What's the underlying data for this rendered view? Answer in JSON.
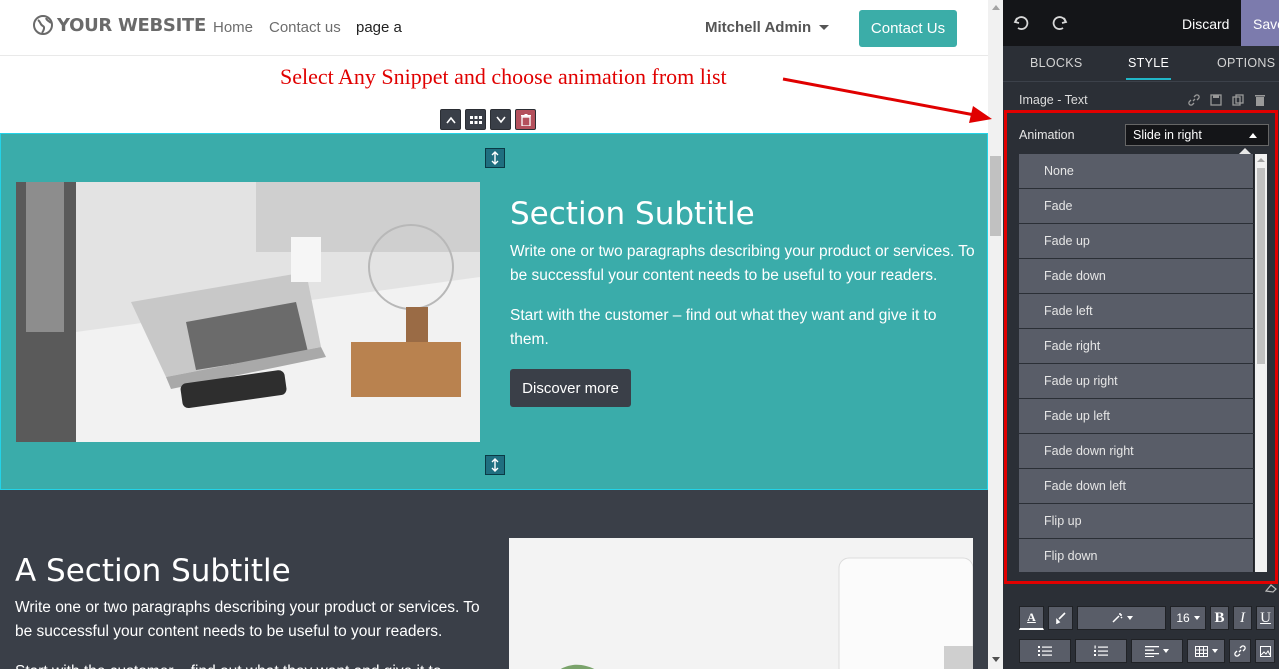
{
  "site": {
    "logo_text": "YOUR WEBSITE",
    "nav": {
      "home": "Home",
      "contact": "Contact us",
      "page_a": "page a"
    },
    "user": "Mitchell Admin",
    "cta": "Contact Us"
  },
  "annotation": "Select Any Snippet and choose animation from list",
  "section1": {
    "title": "Section Subtitle",
    "para1": "Write one or two paragraphs describing your product or services. To be successful your content needs to be useful to your readers.",
    "para2": "Start with the customer – find out what they want and give it to them.",
    "button": "Discover more"
  },
  "section2": {
    "title": "A Section Subtitle",
    "para1": "Write one or two paragraphs describing your product or services. To be successful your content needs to be useful to your readers.",
    "para2_partial": "Start with the customer – find out what they want and give it to"
  },
  "editor": {
    "discard": "Discard",
    "save": "Save",
    "tabs": [
      "BLOCKS",
      "STYLE",
      "OPTIONS"
    ],
    "active_tab": "STYLE",
    "snippet_name": "Image - Text",
    "animation_label": "Animation",
    "animation_value": "Slide in right",
    "animation_options": [
      "None",
      "Fade",
      "Fade up",
      "Fade down",
      "Fade left",
      "Fade right",
      "Fade up right",
      "Fade up left",
      "Fade down right",
      "Fade down left",
      "Flip up",
      "Flip down"
    ],
    "font_size": "16"
  },
  "colors": {
    "teal": "#3aacaa",
    "dark": "#3a3f48",
    "editor_bg": "#2b2f36",
    "accent_red": "#e20000",
    "save_purple": "#7c7bad"
  }
}
